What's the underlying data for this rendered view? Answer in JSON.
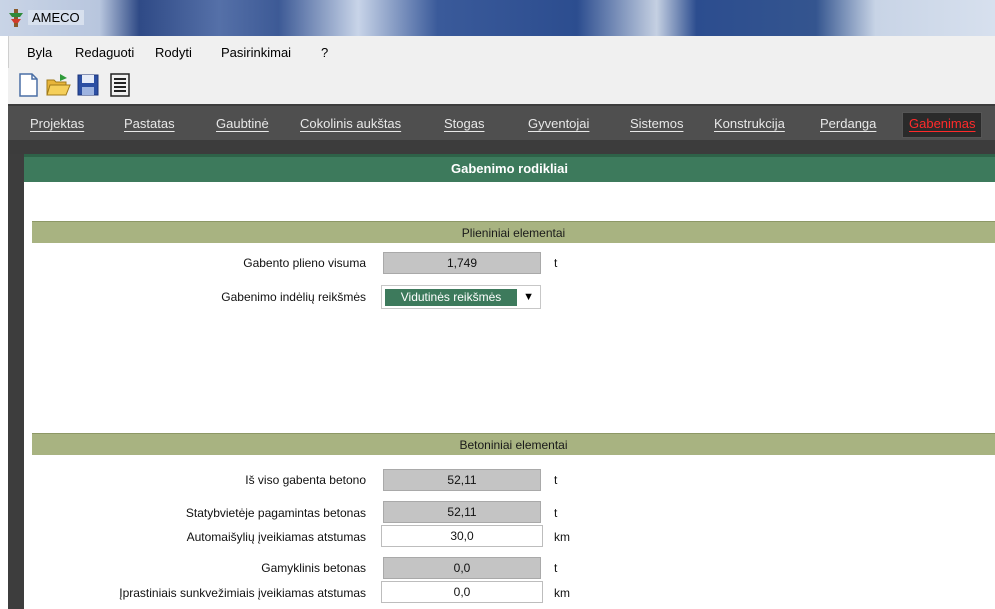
{
  "window": {
    "title": "AMECO"
  },
  "menu": {
    "items": [
      "Byla",
      "Redaguoti",
      "Rodyti",
      "Pasirinkimai",
      "?"
    ]
  },
  "toolbar": {
    "buttons": [
      "new-file-icon",
      "open-folder-icon",
      "save-icon",
      "report-icon"
    ]
  },
  "tabs": {
    "items": [
      "Projektas",
      "Pastatas",
      "Gaubtinė",
      "Cokolinis aukštas",
      "Stogas",
      "Gyventojai",
      "Sistemos",
      "Konstrukcija",
      "Perdanga",
      "Gabenimas"
    ],
    "active": "Gabenimas"
  },
  "main": {
    "title": "Gabenimo rodikliai"
  },
  "steel": {
    "title": "Plieniniai elementai",
    "total_label": "Gabento plieno visuma",
    "total_value": "1,749",
    "total_unit": "t",
    "deposit_label": "Gabenimo indėlių reikšmės",
    "deposit_value": "Vidutinės reikšmės"
  },
  "concrete": {
    "title": "Betoniniai elementai",
    "rows": [
      {
        "label": "Iš viso gabenta betono",
        "value": "52,11",
        "unit": "t",
        "style": "gray"
      },
      {
        "label": "Statybvietėje pagamintas betonas",
        "value": "52,11",
        "unit": "t",
        "style": "gray"
      },
      {
        "label": "Automaišylių įveikiamas atstumas",
        "value": "30,0",
        "unit": "km",
        "style": "white"
      },
      {
        "label": "Gamyklinis betonas",
        "value": "0,0",
        "unit": "t",
        "style": "gray"
      },
      {
        "label": "Įprastiniais sunkvežimiais įveikiamas atstumas",
        "value": "0,0",
        "unit": "km",
        "style": "white"
      }
    ]
  },
  "colors": {
    "header_green": "#3d7a5c",
    "section_olive": "#a8b381",
    "active_tab_text": "#ff2a2a"
  }
}
